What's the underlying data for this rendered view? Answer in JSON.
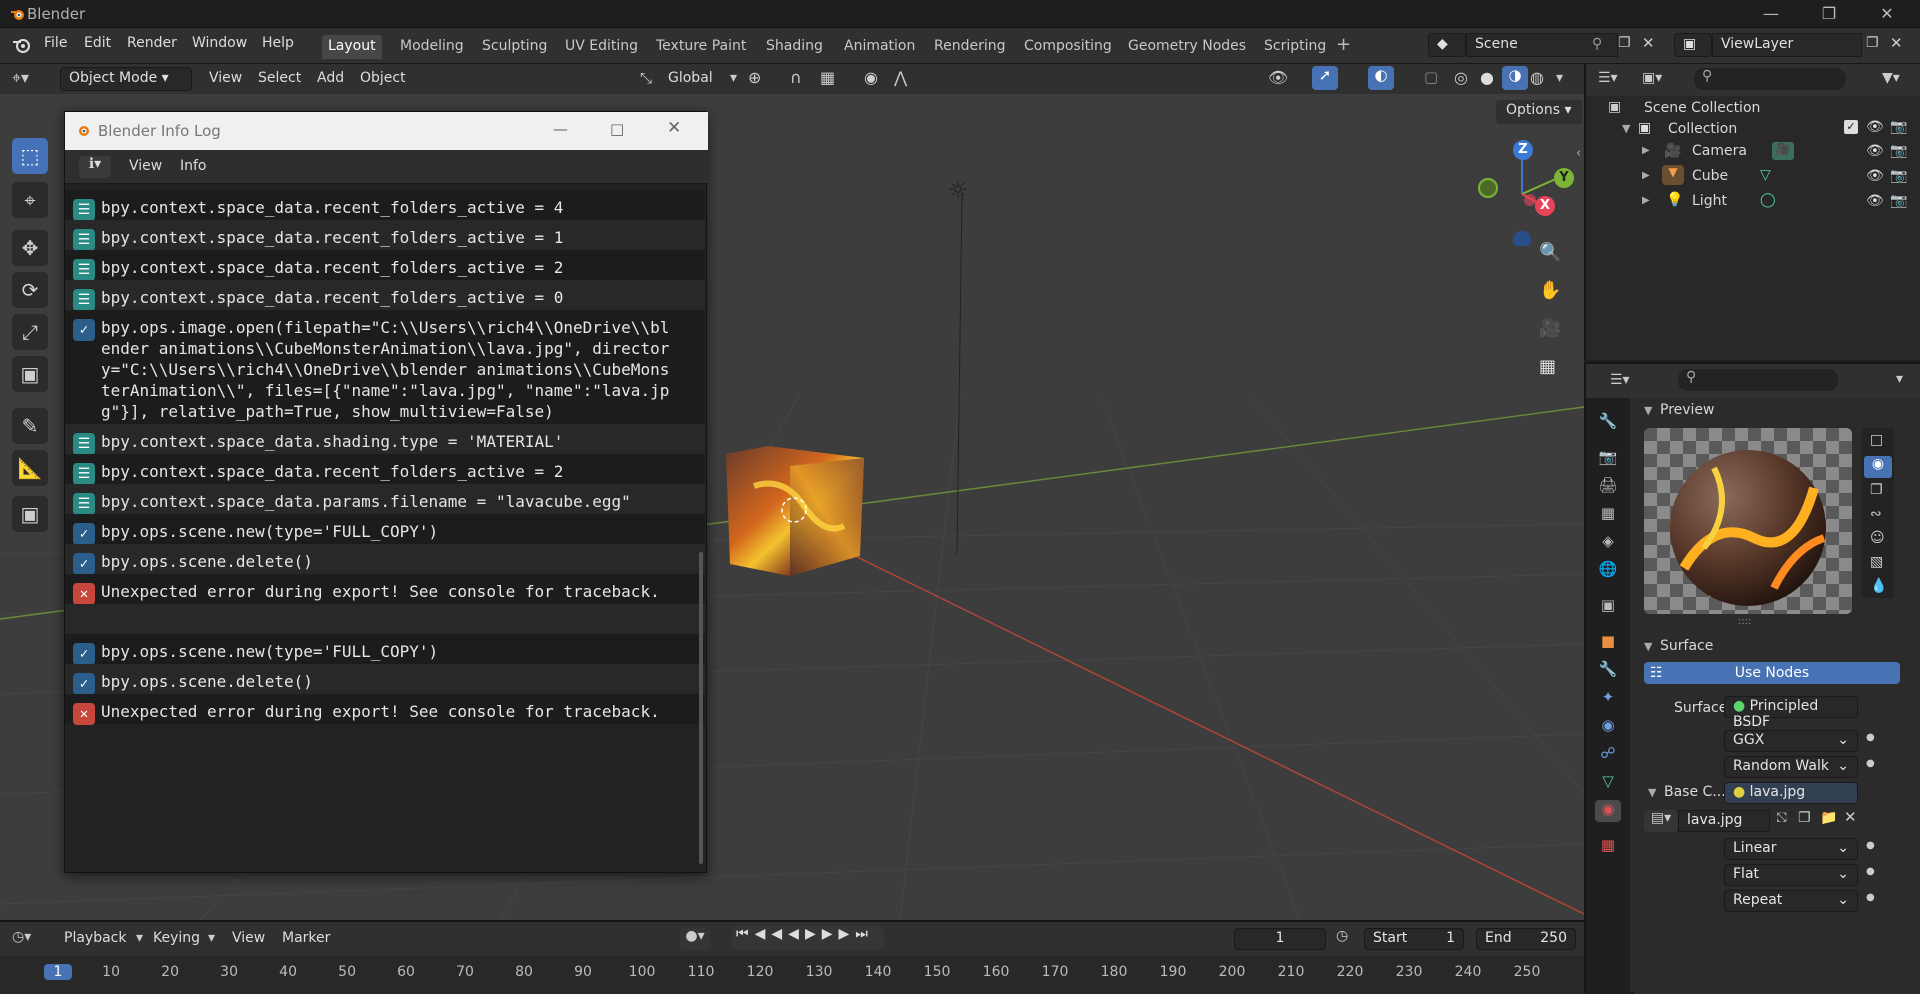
{
  "window": {
    "title": "Blender"
  },
  "menu": {
    "items": [
      "File",
      "Edit",
      "Render",
      "Window",
      "Help"
    ]
  },
  "workspaces": {
    "tabs": [
      "Layout",
      "Modeling",
      "Sculpting",
      "UV Editing",
      "Texture Paint",
      "Shading",
      "Animation",
      "Rendering",
      "Compositing",
      "Geometry Nodes",
      "Scripting"
    ],
    "active": "Layout"
  },
  "scene": {
    "name": "Scene"
  },
  "viewlayer": {
    "name": "ViewLayer"
  },
  "viewport_header": {
    "mode": "Object Mode",
    "menus": [
      "View",
      "Select",
      "Add",
      "Object"
    ],
    "orientation": "Global",
    "options_label": "Options"
  },
  "gizmo": {
    "z": "Z",
    "y": "Y",
    "x": "X"
  },
  "infolog": {
    "title": "Blender Info Log",
    "menus": [
      "View",
      "Info"
    ],
    "entries": [
      {
        "type": "prop",
        "text": "bpy.context.space_data.recent_folders_active = 4"
      },
      {
        "type": "prop",
        "text": "bpy.context.space_data.recent_folders_active = 1"
      },
      {
        "type": "prop",
        "text": "bpy.context.space_data.recent_folders_active = 2"
      },
      {
        "type": "prop",
        "text": "bpy.context.space_data.recent_folders_active = 0"
      },
      {
        "type": "op",
        "text": "bpy.ops.image.open(filepath=\"C:\\\\Users\\\\rich4\\\\OneDrive\\\\bl\nender animations\\\\CubeMonsterAnimation\\\\lava.jpg\", director\ny=\"C:\\\\Users\\\\rich4\\\\OneDrive\\\\blender animations\\\\CubeMons\nterAnimation\\\\\", files=[{\"name\":\"lava.jpg\", \"name\":\"lava.jp\ng\"}], relative_path=True, show_multiview=False)"
      },
      {
        "type": "prop",
        "text": "bpy.context.space_data.shading.type = 'MATERIAL'"
      },
      {
        "type": "prop",
        "text": "bpy.context.space_data.recent_folders_active = 2"
      },
      {
        "type": "prop",
        "text": "bpy.context.space_data.params.filename = \"lavacube.egg\""
      },
      {
        "type": "op",
        "text": "bpy.ops.scene.new(type='FULL_COPY')"
      },
      {
        "type": "op",
        "text": "bpy.ops.scene.delete()"
      },
      {
        "type": "err",
        "text": "Unexpected error during export! See console for traceback."
      },
      {
        "type": "blank",
        "text": ""
      },
      {
        "type": "op",
        "text": "bpy.ops.scene.new(type='FULL_COPY')"
      },
      {
        "type": "op",
        "text": "bpy.ops.scene.delete()"
      },
      {
        "type": "err",
        "text": "Unexpected error during export! See console for traceback."
      }
    ]
  },
  "outliner": {
    "root": "Scene Collection",
    "collection": "Collection",
    "items": [
      "Camera",
      "Cube",
      "Light"
    ]
  },
  "properties": {
    "preview_label": "Preview",
    "surface_panel": "Surface",
    "use_nodes": "Use Nodes",
    "surface_label": "Surface",
    "surface_value": "Principled BSDF",
    "distribution": "GGX",
    "subsurface": "Random Walk",
    "base_color_label": "Base C...",
    "base_color_value": "lava.jpg",
    "image_name": "lava.jpg",
    "interpolation": "Linear",
    "projection": "Flat",
    "extension": "Repeat"
  },
  "timeline": {
    "menus": [
      "Playback",
      "Keying",
      "View",
      "Marker"
    ],
    "current_frame": "1",
    "start_label": "Start",
    "start": "1",
    "end_label": "End",
    "end": "250",
    "ticks": [
      "1",
      "10",
      "20",
      "30",
      "40",
      "50",
      "60",
      "70",
      "80",
      "90",
      "100",
      "110",
      "120",
      "130",
      "140",
      "150",
      "160",
      "170",
      "180",
      "190",
      "200",
      "210",
      "220",
      "230",
      "240",
      "250"
    ]
  },
  "colors": {
    "accent": "#4772b3",
    "error": "#c8473d",
    "prop_icon": "#2a8a84",
    "op_icon": "#2b5e8a"
  }
}
